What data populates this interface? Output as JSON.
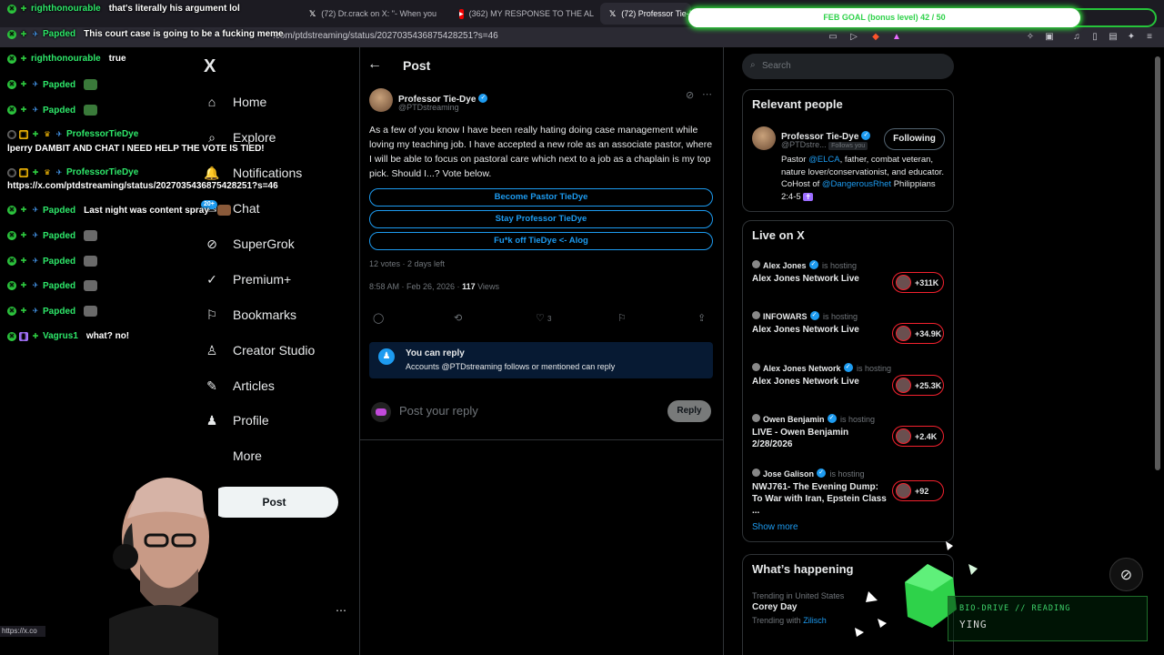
{
  "browser": {
    "tabs": [
      {
        "label": "(72) Dr.crack on X: \"- When you",
        "fav": "X"
      },
      {
        "label": "(362) MY RESPONSE TO THE AL",
        "fav": "yt"
      },
      {
        "label": "(72) Professor Tie-D",
        "fav": "X"
      }
    ],
    "url": ".com/ptdstreaming/status/2027035436875428251?s=46",
    "status_url": "https://x.co"
  },
  "goal": {
    "text": "FEB GOAL (bonus level) 42 / 50",
    "current": 42,
    "target": 50
  },
  "chat": [
    {
      "user": "righthonourable",
      "color": "#2ee86a",
      "badges": [
        "x",
        "g"
      ],
      "msg": "that's literally his argument lol",
      "emote": ""
    },
    {
      "user": "Papded",
      "color": "#2ee86a",
      "badges": [
        "x",
        "g",
        "s"
      ],
      "msg": "This court case is going to be a fucking meme",
      "emote": ""
    },
    {
      "user": "righthonourable",
      "color": "#2ee86a",
      "badges": [
        "x",
        "g"
      ],
      "msg": "true",
      "emote": ""
    },
    {
      "user": "Papded",
      "color": "#2ee86a",
      "badges": [
        "x",
        "g",
        "s"
      ],
      "msg": "",
      "emote": "#3a7a3a"
    },
    {
      "user": "Papded",
      "color": "#2ee86a",
      "badges": [
        "x",
        "g",
        "s"
      ],
      "msg": "",
      "emote": "#3a7a3a"
    },
    {
      "user": "ProfessorTieDye",
      "color": "#2ee86a",
      "badges": [
        "o",
        "p",
        "g",
        "c",
        "s"
      ],
      "msg": "",
      "emote": ""
    },
    {
      "user": "",
      "color": "#ffffff",
      "badges": [],
      "msg": "lperry DAMBIT AND CHAT I NEED HELP THE VOTE IS TIED!",
      "emote": ""
    },
    {
      "user": "ProfessorTieDye",
      "color": "#2ee86a",
      "badges": [
        "o",
        "p",
        "g",
        "c",
        "s"
      ],
      "msg": "",
      "emote": ""
    },
    {
      "user": "",
      "color": "#ffffff",
      "badges": [],
      "msg": "https://x.com/ptdstreaming/status/2027035436875428251?s=46",
      "emote": ""
    },
    {
      "user": "Papded",
      "color": "#2ee86a",
      "badges": [
        "x",
        "g",
        "s"
      ],
      "msg": "Last night was content spray",
      "emote": "#8a5a3a"
    },
    {
      "user": "Papded",
      "color": "#2ee86a",
      "badges": [
        "x",
        "g",
        "s"
      ],
      "msg": "",
      "emote": "#6a6a6a"
    },
    {
      "user": "Papded",
      "color": "#2ee86a",
      "badges": [
        "x",
        "g",
        "s"
      ],
      "msg": "",
      "emote": "#6a6a6a"
    },
    {
      "user": "Papded",
      "color": "#2ee86a",
      "badges": [
        "x",
        "g",
        "s"
      ],
      "msg": "",
      "emote": "#6a6a6a"
    },
    {
      "user": "Papded",
      "color": "#2ee86a",
      "badges": [
        "x",
        "g",
        "s"
      ],
      "msg": "",
      "emote": "#6a6a6a"
    },
    {
      "user": "Vagrus1",
      "color": "#2ee86a",
      "badges": [
        "x",
        "v",
        "g"
      ],
      "msg": "what? no!",
      "emote": ""
    }
  ],
  "nav": {
    "logo": "X",
    "items": [
      {
        "label": "Home",
        "icon": "home-icon",
        "glyph": "⌂"
      },
      {
        "label": "Explore",
        "icon": "search-icon",
        "glyph": "⌕"
      },
      {
        "label": "Notifications",
        "icon": "bell-icon",
        "glyph": "🔔"
      },
      {
        "label": "Chat",
        "icon": "chat-icon",
        "glyph": "✉"
      },
      {
        "label": "SuperGrok",
        "icon": "grok-icon",
        "glyph": "⊘"
      },
      {
        "label": "Premium+",
        "icon": "premium-icon",
        "glyph": "✓"
      },
      {
        "label": "Bookmarks",
        "icon": "bookmark-icon",
        "glyph": "⚐"
      },
      {
        "label": "Creator Studio",
        "icon": "creator-icon",
        "glyph": "♙"
      },
      {
        "label": "Articles",
        "icon": "articles-icon",
        "glyph": "✎"
      },
      {
        "label": "Profile",
        "icon": "profile-icon",
        "glyph": "♟"
      },
      {
        "label": "More",
        "icon": "more-icon",
        "glyph": "⋯"
      }
    ],
    "notif_badge": "20+",
    "post_label": "Post"
  },
  "post": {
    "header": "Post",
    "author": "Professor Tie-Dye",
    "handle": "@PTDstreaming",
    "text": "As a few of you know I have been really hating doing case management while loving my teaching job. I have accepted a new role as an associate pastor, where I will be able to focus on pastoral care which next to a job as a chaplain is my top pick. Should I...? Vote below.",
    "poll": [
      "Become Pastor TieDye",
      "Stay Professor TieDye",
      "Fu*k off TieDye <- Alog"
    ],
    "votes": "12 votes · 2 days left",
    "time": "8:58 AM · Feb 26, 2026 · ",
    "views_count": "117",
    "views_label": " Views",
    "likes": "3",
    "reply_notice_title": "You can reply",
    "reply_notice_sub": "Accounts @PTDstreaming follows or mentioned can reply",
    "compose_placeholder": "Post your reply",
    "reply_btn": "Reply"
  },
  "sidebar": {
    "search_placeholder": "Search",
    "relevant_title": "Relevant people",
    "person": {
      "name": "Professor Tie-Dye",
      "handle": "@PTDstre...",
      "follows_you": "Follows you",
      "follow_btn": "Following",
      "bio_1": "Pastor ",
      "bio_link1": "@ELCA",
      "bio_2": ", father, combat veteran, nature lover/conservationist, and educator. CoHost of ",
      "bio_link2": "@DangerousRhet",
      "bio_3": " Philippians 2:4-5",
      "bio_cross": "✝"
    },
    "live_title": "Live on X",
    "live": [
      {
        "host": "Alex Jones",
        "verified": true,
        "hosting": "is hosting",
        "title": "Alex Jones Network Live",
        "count": "+311K"
      },
      {
        "host": "INFOWARS",
        "verified": true,
        "hosting": "is hosting",
        "title": "Alex Jones Network Live",
        "count": "+34.9K"
      },
      {
        "host": "Alex Jones Network",
        "verified": true,
        "hosting": "is hosting",
        "title": "Alex Jones Network Live",
        "count": "+25.3K"
      },
      {
        "host": "Owen Benjamin",
        "verified": true,
        "hosting": "is hosting",
        "title": "LIVE - Owen Benjamin 2/28/2026",
        "count": "+2.4K"
      },
      {
        "host": "Jose Galison",
        "verified": true,
        "hosting": "is hosting",
        "title": "NWJ761- The Evening Dump: To War with Iran, Epstein Class ...",
        "count": "+92"
      }
    ],
    "show_more": "Show more",
    "happening_title": "What’s happening",
    "trend_context": "Trending in United States",
    "trend_name": "Corey Day",
    "trend_with": "Trending with ",
    "trend_with_link": "Zilisch"
  },
  "overlay": {
    "line1": "BIO-DRIVE // READING",
    "line2": "YING"
  },
  "colors": {
    "accent": "#1d9bf0",
    "live": "#f4212e",
    "goal_green": "#26c43a"
  }
}
